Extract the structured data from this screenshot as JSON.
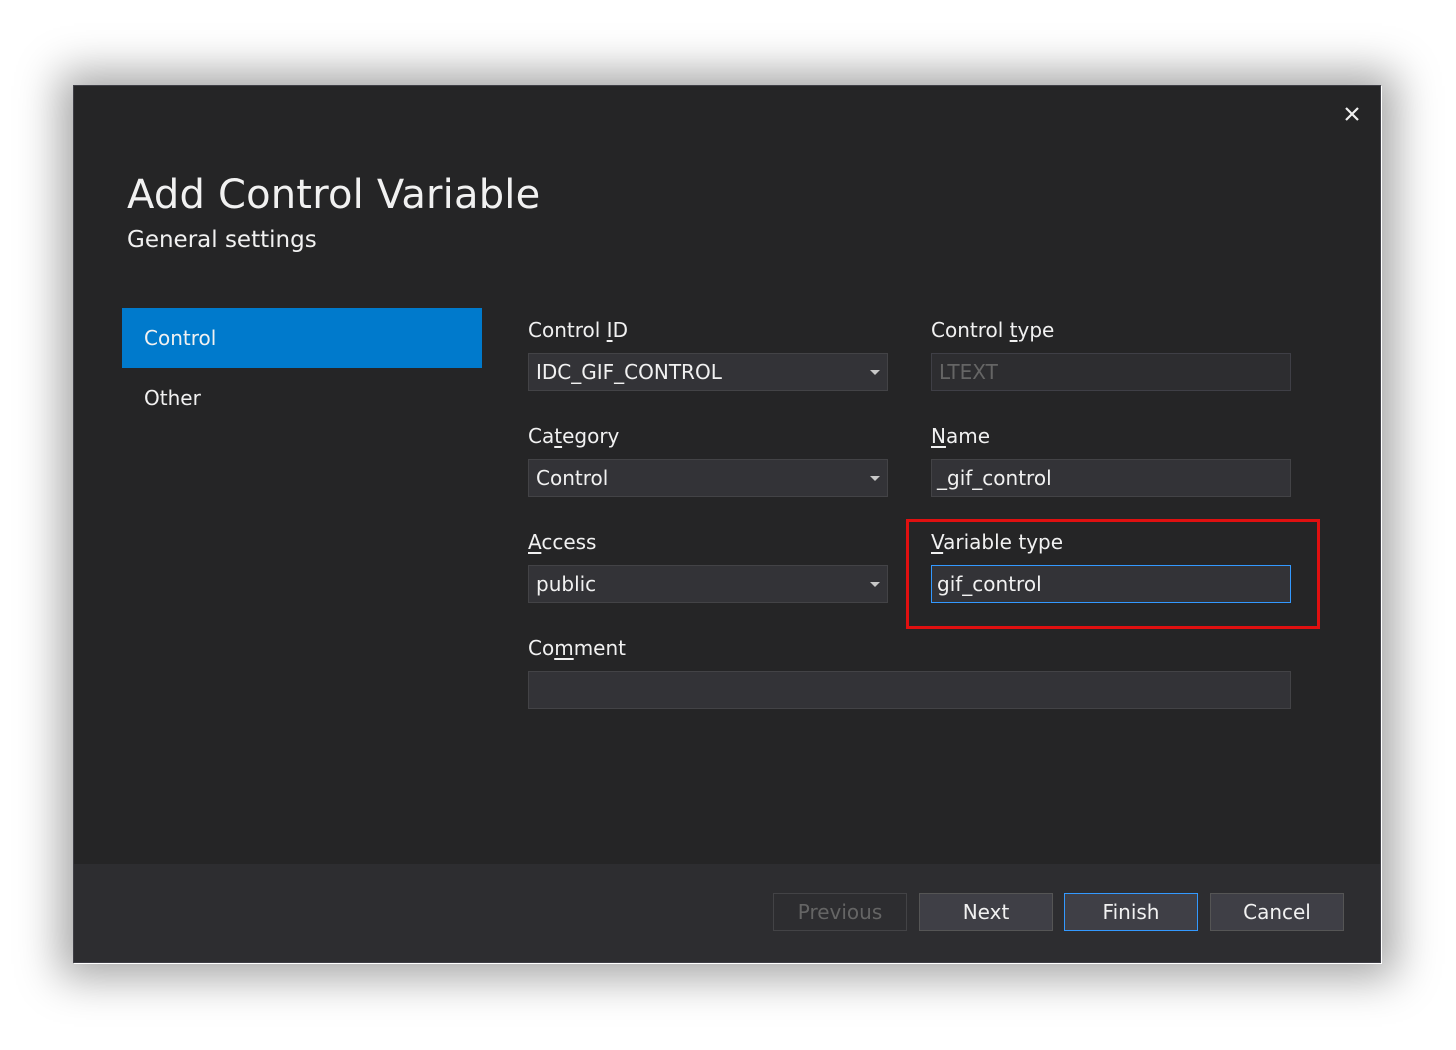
{
  "dialog": {
    "title": "Add Control Variable",
    "subtitle": "General settings",
    "close_icon": "close-icon"
  },
  "nav": {
    "items": [
      {
        "label": "Control",
        "selected": true
      },
      {
        "label": "Other",
        "selected": false
      }
    ]
  },
  "form": {
    "control_id": {
      "label_pre": "Control ",
      "label_key": "I",
      "label_post": "D",
      "value": "IDC_GIF_CONTROL"
    },
    "control_type": {
      "label_pre": "Control ",
      "label_key": "t",
      "label_post": "ype",
      "value": "LTEXT"
    },
    "category": {
      "label_pre": "Ca",
      "label_key": "t",
      "label_post": "egory",
      "value": "Control"
    },
    "name": {
      "label_pre": "",
      "label_key": "N",
      "label_post": "ame",
      "value": "_gif_control"
    },
    "access": {
      "label_pre": "",
      "label_key": "A",
      "label_post": "ccess",
      "value": "public"
    },
    "variable_type": {
      "label_pre": "",
      "label_key": "V",
      "label_post": "ariable type",
      "value": "gif_control"
    },
    "comment": {
      "label_pre": "Co",
      "label_key": "m",
      "label_post": "ment",
      "value": ""
    }
  },
  "footer": {
    "previous_label": "Previous",
    "next_label": "Next",
    "finish_label": "Finish",
    "cancel_label": "Cancel"
  },
  "colors": {
    "background": "#252526",
    "accent": "#007acc",
    "focus_border": "#3399ff",
    "highlight": "#e01010"
  }
}
